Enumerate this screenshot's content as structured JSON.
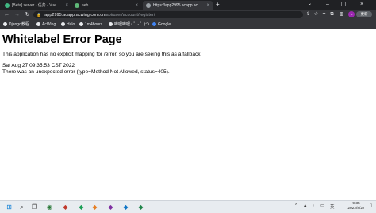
{
  "tabs": [
    {
      "title": "[Beta] server - 任务 - Vue CLI",
      "active": false
    },
    {
      "title": "aeb",
      "active": false
    },
    {
      "title": "https://app2995.acapp.acwing.c",
      "active": true
    }
  ],
  "new_tab": "+",
  "omnibox": {
    "host": "app2995.acapp.acwing.com.cn",
    "path": "/api/user/account/register/"
  },
  "profile_initial": "L",
  "update_label": "更新",
  "bookmarks": [
    {
      "label": "Django教程"
    },
    {
      "label": "AcWing"
    },
    {
      "label": "Halo"
    },
    {
      "label": "1m4hours"
    },
    {
      "label": "哔哩哔哩 ( ゜- ゜)つ..."
    },
    {
      "label": "Google"
    }
  ],
  "page": {
    "title": "Whitelabel Error Page",
    "message": "This application has no explicit mapping for /error, so you are seeing this as a fallback.",
    "timestamp": "Sat Aug 27 09:35:53 CST 2022",
    "error": "There was an unexpected error (type=Method Not Allowed, status=405)."
  },
  "tray": {
    "ime": "英"
  },
  "clock": {
    "time": "9:35",
    "date": "2022/8/27"
  },
  "colors": {
    "tab_bg": "#202124",
    "toolbar_bg": "#35363a",
    "taskbar_bg": "#e8ecf0",
    "avatar": "#9c27b0"
  }
}
